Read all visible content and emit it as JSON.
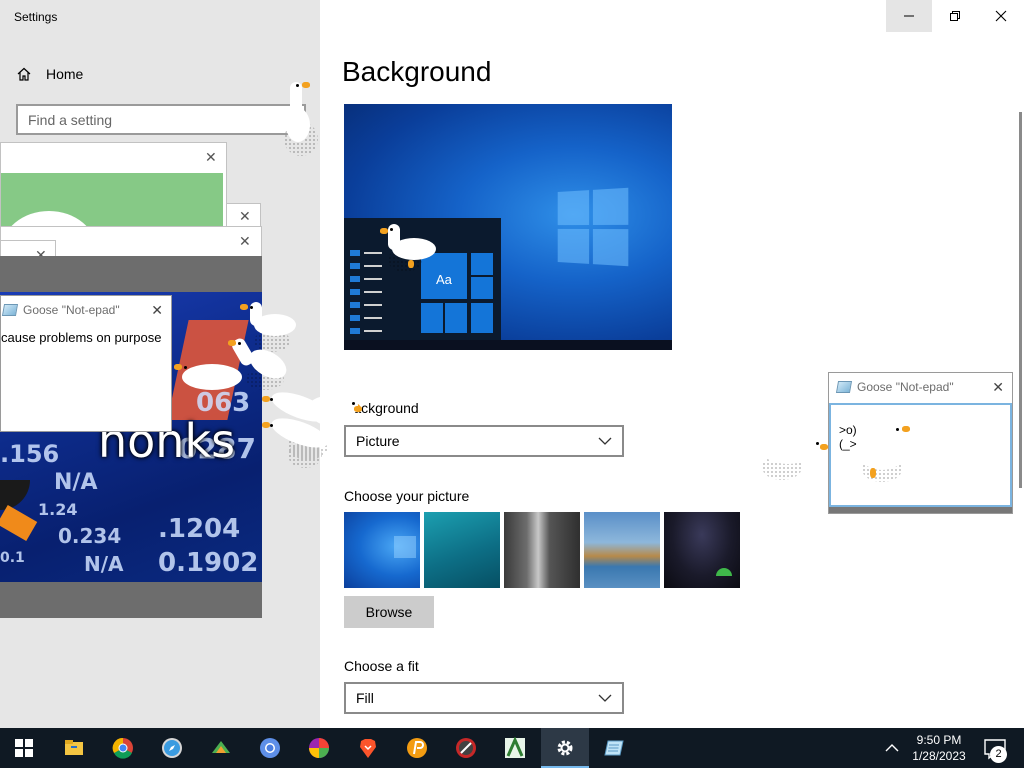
{
  "window": {
    "title": "Settings",
    "minimize_glyph": "–",
    "maximize_glyph": "❒",
    "close_glyph": "✕"
  },
  "sidebar": {
    "home_label": "Home",
    "search_placeholder": "Find a setting"
  },
  "main": {
    "page_title": "Background",
    "preview_tile_text": "Aa",
    "background_label": "Background",
    "background_value": "Picture",
    "choose_picture_label": "Choose your picture",
    "browse_label": "Browse",
    "choose_fit_label": "Choose a fit",
    "fit_value": "Fill"
  },
  "goose_notepad_right": {
    "title": "Goose \"Not-epad\"",
    "close_glyph": "✕",
    "text": ">o)\n(_>"
  },
  "goose_notepad_left": {
    "title": "Goose \"Not-epad\"",
    "close_glyph": "✕",
    "text": "cause problems on purpose"
  },
  "meme": {
    "caption": "honks",
    "numbers": [
      ".156",
      "0287",
      ".1204",
      "0.234",
      "0.1902",
      "N/A",
      "N/A",
      "1.24",
      "063",
      "0.1"
    ]
  },
  "left_windows": {
    "close_glyph": "✕"
  },
  "taskbar": {
    "time": "9:50 PM",
    "date": "1/28/2023",
    "notification_count": "2",
    "icons": [
      "windows-start-icon",
      "file-explorer-icon",
      "chrome-icon",
      "safari-icon",
      "game-app-icon",
      "chromium-icon",
      "color-wheel-app-icon",
      "brave-icon",
      "orange-p-app-icon",
      "media-player-icon",
      "green-a-app-icon",
      "settings-gear-icon",
      "notepad-icon"
    ]
  },
  "colors": {
    "taskbar_bg": "#0f1923",
    "sidebar_bg": "#e6e6e6",
    "accent": "#76b9ed",
    "goose_beak": "#f3a11f"
  }
}
